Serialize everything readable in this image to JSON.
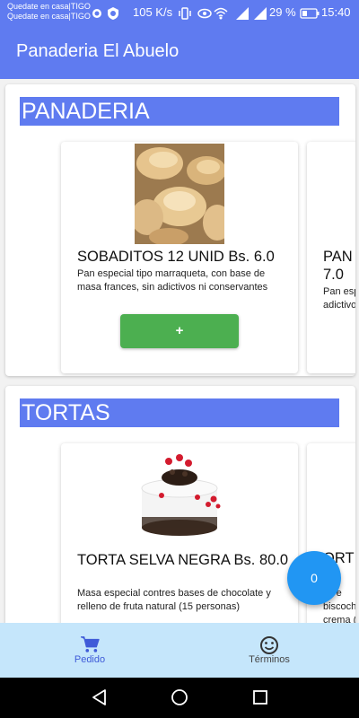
{
  "status_bar": {
    "carrier_line1": "Quedate en casa|TIGO",
    "carrier_line2": "Quedate en casa|TIGO",
    "speed": "105 K/s",
    "battery": "29 %",
    "time": "15:40"
  },
  "app_bar": {
    "title": "Panaderia El Abuelo"
  },
  "sections": [
    {
      "title": "PANADERIA",
      "product": {
        "name": "SOBADITOS 12 UNID Bs. 6.0",
        "description": "Pan especial tipo marraqueta, con base de masa frances, sin adictivos ni conservantes",
        "add_label": "+"
      },
      "peek": {
        "name_1": "PAN",
        "name_2": "7.0",
        "desc_1": "Pan esp",
        "desc_2": "adictivo"
      }
    },
    {
      "title": "TORTAS",
      "product": {
        "name": "TORTA SELVA NEGRA Bs. 80.0",
        "description": "Masa especial contres bases de chocolate y relleno de fruta natural (15 personas)"
      },
      "peek": {
        "name_1": "ORT",
        "name_2": "C",
        "desc_1": "sa e",
        "desc_2": "biscoch",
        "desc_3": "crema ("
      }
    }
  ],
  "fab": {
    "count": "0"
  },
  "bottom_nav": {
    "pedido": "Pedido",
    "terminos": "Términos"
  },
  "colors": {
    "primary": "#5f7bf0",
    "green": "#4caf50",
    "fab": "#2196f3",
    "nav_bg": "#c5e6fb"
  }
}
